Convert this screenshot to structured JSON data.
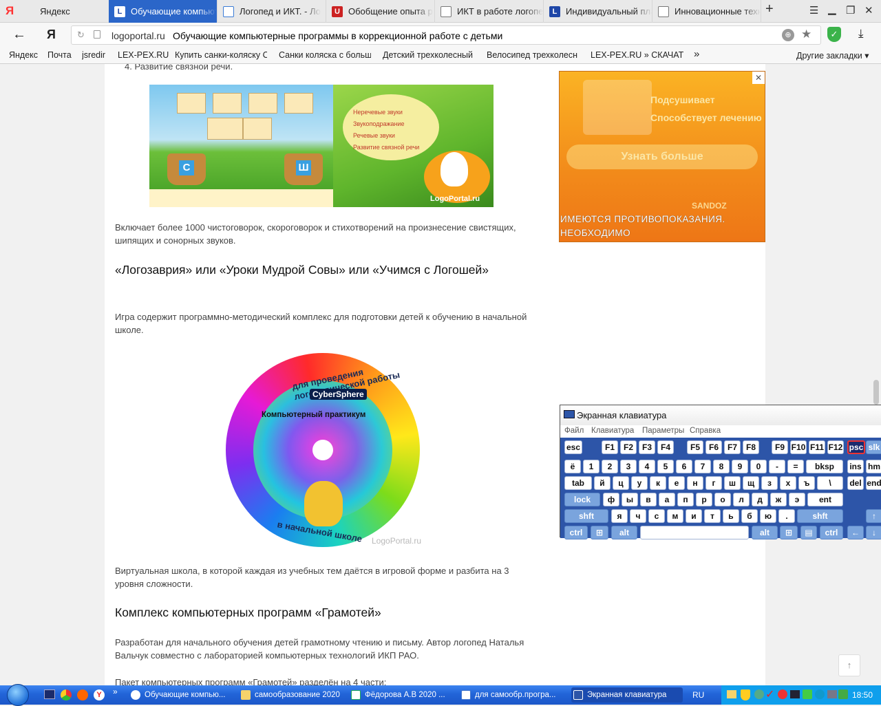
{
  "browser": {
    "tabs": [
      {
        "label": "Яндекс",
        "favicon": "yandex-icon"
      },
      {
        "label": "Обучающие компьютерные",
        "favicon": "logoportal-icon",
        "active": true
      },
      {
        "label": "Логопед и ИКТ. - Ло",
        "favicon": "doc-icon"
      },
      {
        "label": "Обобщение опыта р",
        "favicon": "red-icon"
      },
      {
        "label": "ИКТ в работе логопе",
        "favicon": "presentation-icon"
      },
      {
        "label": "Индивидуальный пла",
        "favicon": "logoportal-icon"
      },
      {
        "label": "Инновационные техн",
        "favicon": "presentation-icon"
      }
    ],
    "address": {
      "domain": "logoportal.ru",
      "title": "Обучающие компьютерные программы в коррекционной работе с детьми"
    },
    "bookmarks": [
      "Яндекс",
      "Почта",
      "jsredir",
      "LEX-PEX.RU",
      "Купить санки-коляску С",
      "Санки коляска с больш",
      "Детский трехколесный",
      "Велосипед трехколесн",
      "LEX-PEX.RU » СКАЧАТЬ"
    ],
    "bookmarks_more": "»",
    "other_bookmarks": "Другие закладки"
  },
  "article": {
    "list_item": "4. Развитие связной речи.",
    "banner_menu": [
      "Неречевые звуки",
      "Звукоподражание",
      "Речевые звуки",
      "Развитие связной речи"
    ],
    "banner_letters": [
      "С",
      "Ш"
    ],
    "banner_watermark": "LogoPortal.ru",
    "p1": "Включает более 1000 чистоговорок, скороговорок и стихотворений на произнесение свистящих, шипящих и сонорных звуков.",
    "h1": "«Логозаврия» или «Уроки Мудрой Совы» или «Учимся с Логошей»",
    "p2": "Игра содержит программно-методический комплекс для подготовки детей к обучению в начальной школе.",
    "disc_top": "для проведения логопедической работы",
    "disc_brand": "CyberSphere",
    "disc_label": "Компьютерный практикум",
    "disc_bottom": "в начальной школе",
    "disc_watermark": "LogoPortal.ru",
    "p3": "Виртуальная школа, в которой каждая из учебных тем даётся в игровой форме и разбита на 3 уровня сложности.",
    "h2": "Комплекс компьютерных программ «Грамотей»",
    "p4": "Разработан для начального обучения детей грамотному чтению и письму. Автор логопед Наталья Вальчук совместно с лабораторией компьютерных технологий ИКП РАО.",
    "p5": "Пакет компьютерных программ «Грамотей» разделён на 4 части:"
  },
  "ad": {
    "bullets": [
      "Подсушивает",
      "Способствует лечению"
    ],
    "button": "Узнать больше",
    "brand": "SANDOZ",
    "warning": "ИМЕЮТСЯ ПРОТИВОПОКАЗАНИЯ. НЕОБХОДИМО ПРОКОНСУЛЬТИРОВАТЬСЯ СО СПЕЦИАЛИСТОМ",
    "close": "✕"
  },
  "osk": {
    "title": "Экранная клавиатура",
    "menu": [
      "Файл",
      "Клавиатура",
      "Параметры",
      "Справка"
    ]
  },
  "taskbar": {
    "items": [
      "Обучающие компью...",
      "самообразование 2020",
      "Фёдорова А.В 2020 ...",
      "для самообр.програ...",
      "Экранная клавиатура"
    ],
    "lang": "RU",
    "clock": "18:50"
  }
}
